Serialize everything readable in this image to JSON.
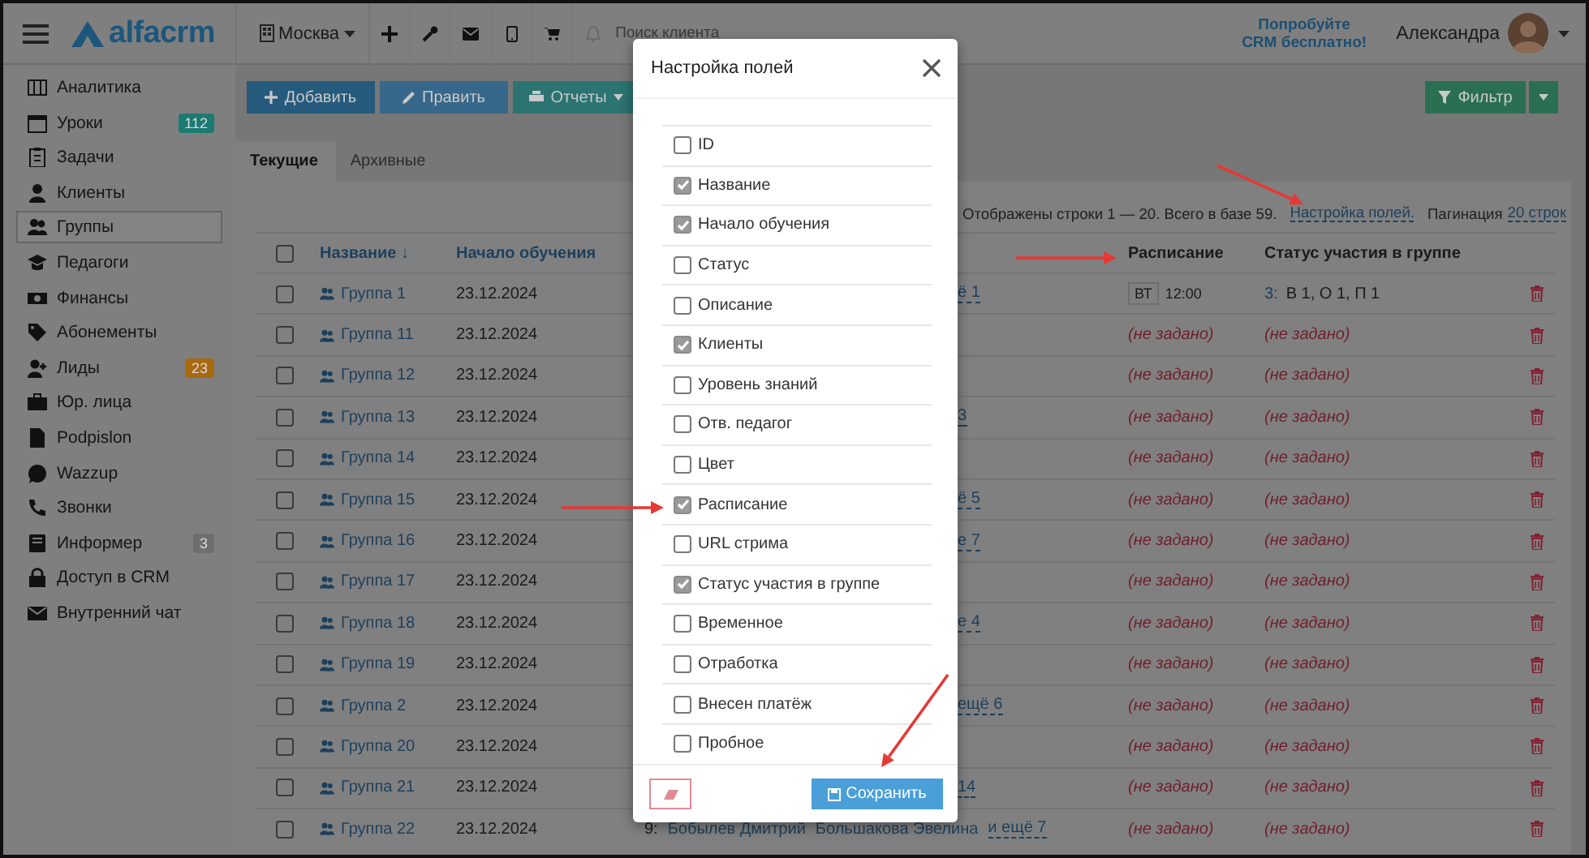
{
  "topbar": {
    "logo": "alfacrm",
    "branch": "Москва",
    "search": {
      "placeholder": "Поиск клиента"
    },
    "promo": [
      "Попробуйте",
      "CRM бесплатно!"
    ],
    "user": "Александра"
  },
  "sidebar": {
    "items": [
      {
        "label": "Аналитика",
        "selected": false
      },
      {
        "label": "Уроки",
        "selected": false,
        "badge": "112",
        "color": "#1b7a72"
      },
      {
        "label": "Задачи",
        "selected": false
      },
      {
        "label": "Клиенты",
        "selected": false
      },
      {
        "label": "Группы",
        "selected": true
      },
      {
        "label": "Педагоги",
        "selected": false
      },
      {
        "label": "Финансы",
        "selected": false
      },
      {
        "label": "Абонементы",
        "selected": false
      },
      {
        "label": "Лиды",
        "selected": false,
        "badge": "23",
        "color": "#a8690f"
      },
      {
        "label": "Юр. лица",
        "selected": false
      },
      {
        "label": "Podpislon",
        "selected": false
      },
      {
        "label": "Wazzup",
        "selected": false
      },
      {
        "label": "Звонки",
        "selected": false
      },
      {
        "label": "Информер",
        "selected": false,
        "badge": "3",
        "color": "#6e6e6e"
      },
      {
        "label": "Доступ в CRM",
        "selected": false
      },
      {
        "label": "Внутренний чат",
        "selected": false
      }
    ]
  },
  "toolbar": {
    "buttons": [
      {
        "label": "Добавить",
        "kind": "add"
      },
      {
        "label": "Править",
        "kind": "edit"
      },
      {
        "label": "Отчеты",
        "kind": "reports"
      }
    ],
    "filter": "Фильтр"
  },
  "tabs": [
    {
      "label": "Текущие",
      "selected": true
    },
    {
      "label": "Архивные",
      "selected": false
    }
  ],
  "summary": {
    "text": "Отображены строки 1 — 20. Всего в базе 59.",
    "fields_link": "Настройка полей.",
    "pagination_label": "Пагинация",
    "pagination_link": "20 строк"
  },
  "table": {
    "header_checked": false,
    "columns": [
      {
        "label": "Название ↓"
      },
      {
        "label": "Начало обучения"
      },
      {
        "label": "Расписание"
      },
      {
        "label": "Статус участия в группе"
      }
    ],
    "rows": [
      {
        "checked": false,
        "name": "Группа 1",
        "start": "23.12.2024",
        "clients": {
          "kind": "fragment",
          "more": "ё 1"
        },
        "schedule": {
          "kind": "slot",
          "day": "ВТ",
          "time": "12:00"
        },
        "status": {
          "kind": "counts",
          "count": "3:",
          "text": "В 1, О 1, П 1"
        }
      },
      {
        "checked": false,
        "name": "Группа 11",
        "start": "23.12.2024",
        "schedule": {
          "kind": "empty",
          "text": "(не задано)"
        },
        "status": {
          "kind": "empty",
          "text": "(не задано)"
        }
      },
      {
        "checked": false,
        "name": "Группа 12",
        "start": "23.12.2024",
        "schedule": {
          "kind": "empty",
          "text": "(не задано)"
        },
        "status": {
          "kind": "empty",
          "text": "(не задано)"
        }
      },
      {
        "checked": false,
        "name": "Группа 13",
        "start": "23.12.2024",
        "clients": {
          "kind": "fragment",
          "more": "3"
        },
        "schedule": {
          "kind": "empty",
          "text": "(не задано)"
        },
        "status": {
          "kind": "empty",
          "text": "(не задано)"
        }
      },
      {
        "checked": false,
        "name": "Группа 14",
        "start": "23.12.2024",
        "schedule": {
          "kind": "empty",
          "text": "(не задано)"
        },
        "status": {
          "kind": "empty",
          "text": "(не задано)"
        }
      },
      {
        "checked": false,
        "name": "Группа 15",
        "start": "23.12.2024",
        "clients": {
          "kind": "fragment",
          "more": "ё 5"
        },
        "schedule": {
          "kind": "empty",
          "text": "(не задано)"
        },
        "status": {
          "kind": "empty",
          "text": "(не задано)"
        }
      },
      {
        "checked": false,
        "name": "Группа 16",
        "start": "23.12.2024",
        "clients": {
          "kind": "fragment",
          "more": "е 7"
        },
        "schedule": {
          "kind": "empty",
          "text": "(не задано)"
        },
        "status": {
          "kind": "empty",
          "text": "(не задано)"
        }
      },
      {
        "checked": false,
        "name": "Группа 17",
        "start": "23.12.2024",
        "schedule": {
          "kind": "empty",
          "text": "(не задано)"
        },
        "status": {
          "kind": "empty",
          "text": "(не задано)"
        }
      },
      {
        "checked": false,
        "name": "Группа 18",
        "start": "23.12.2024",
        "clients": {
          "kind": "fragment",
          "more": "е 4"
        },
        "schedule": {
          "kind": "empty",
          "text": "(не задано)"
        },
        "status": {
          "kind": "empty",
          "text": "(не задано)"
        }
      },
      {
        "checked": false,
        "name": "Группа 19",
        "start": "23.12.2024",
        "schedule": {
          "kind": "empty",
          "text": "(не задано)"
        },
        "status": {
          "kind": "empty",
          "text": "(не задано)"
        }
      },
      {
        "checked": false,
        "name": "Группа 2",
        "start": "23.12.2024",
        "clients": {
          "kind": "fragment",
          "more": "ещё 6"
        },
        "schedule": {
          "kind": "empty",
          "text": "(не задано)"
        },
        "status": {
          "kind": "empty",
          "text": "(не задано)"
        }
      },
      {
        "checked": false,
        "name": "Группа 20",
        "start": "23.12.2024",
        "schedule": {
          "kind": "empty",
          "text": "(не задано)"
        },
        "status": {
          "kind": "empty",
          "text": "(не задано)"
        }
      },
      {
        "checked": false,
        "name": "Группа 21",
        "start": "23.12.2024",
        "clients": {
          "kind": "fragment",
          "more": "14"
        },
        "schedule": {
          "kind": "empty",
          "text": "(не задано)"
        },
        "status": {
          "kind": "empty",
          "text": "(не задано)"
        }
      },
      {
        "checked": false,
        "name": "Группа 22",
        "start": "23.12.2024",
        "clients": {
          "kind": "list",
          "count": "9:",
          "names": [
            "Бобылев Дмитрий",
            "Большакова Эвелина"
          ],
          "more": "и ещё 7"
        },
        "schedule": {
          "kind": "empty",
          "text": "(не задано)"
        },
        "status": {
          "kind": "empty",
          "text": "(не задано)"
        }
      }
    ]
  },
  "modal": {
    "title": "Настройка полей",
    "fields": [
      {
        "label": "ID",
        "checked": false
      },
      {
        "label": "Название",
        "checked": true
      },
      {
        "label": "Начало обучения",
        "checked": true
      },
      {
        "label": "Статус",
        "checked": false
      },
      {
        "label": "Описание",
        "checked": false
      },
      {
        "label": "Клиенты",
        "checked": true
      },
      {
        "label": "Уровень знаний",
        "checked": false
      },
      {
        "label": "Отв. педагог",
        "checked": false
      },
      {
        "label": "Цвет",
        "checked": false
      },
      {
        "label": "Расписание",
        "checked": true
      },
      {
        "label": "URL стрима",
        "checked": false
      },
      {
        "label": "Статус участия в группе",
        "checked": true
      },
      {
        "label": "Временное",
        "checked": false
      },
      {
        "label": "Отработка",
        "checked": false
      },
      {
        "label": "Внесен платёж",
        "checked": false
      },
      {
        "label": "Пробное",
        "checked": false
      }
    ],
    "save": "Сохранить"
  }
}
